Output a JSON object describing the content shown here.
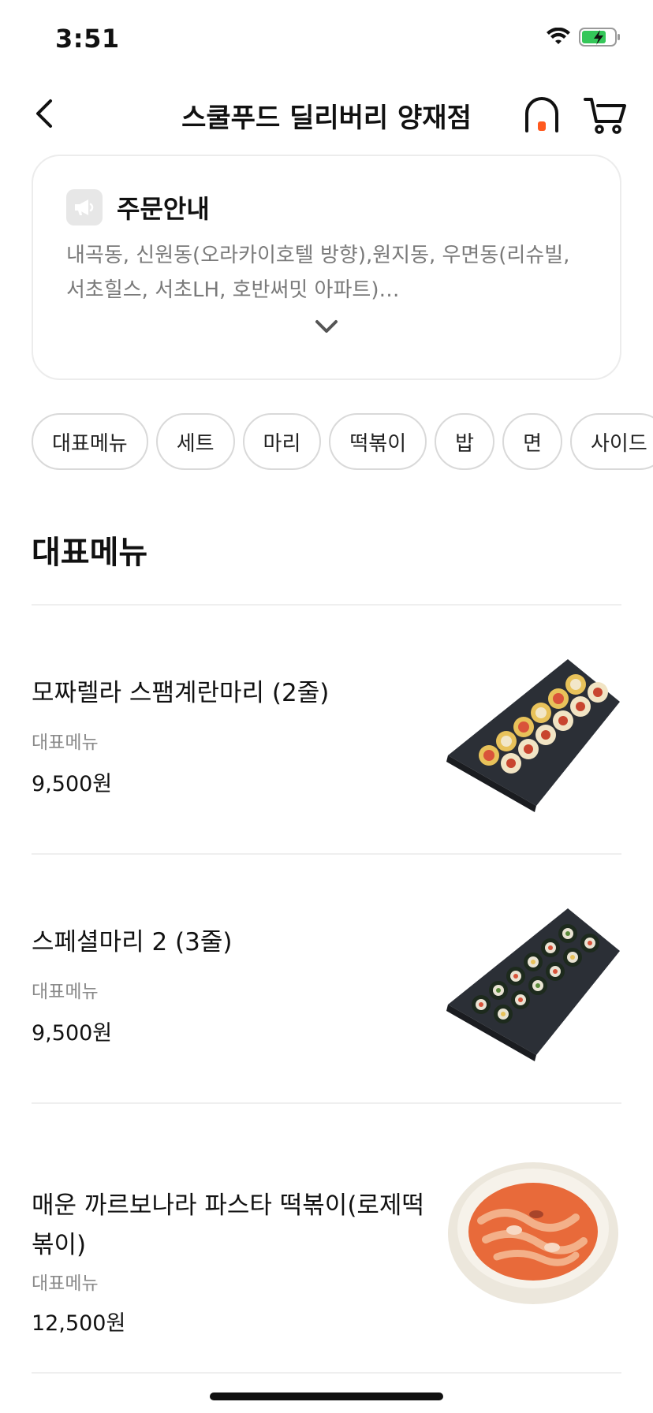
{
  "status_bar": {
    "time": "3:51"
  },
  "header": {
    "title": "스쿨푸드 딜리버리 양재점"
  },
  "notice": {
    "title": "주문안내",
    "line1": "내곡동, 신원동(오라카이호텔 방향),원지동, 우면동(리슈빌,",
    "line2": "서초힐스, 서초LH, 호반써밋 아파트)…"
  },
  "categories": [
    "대표메뉴",
    "세트",
    "마리",
    "떡볶이",
    "밥",
    "면",
    "사이드"
  ],
  "section": {
    "title": "대표메뉴"
  },
  "menu_items": [
    {
      "name": "모짜렐라 스팸계란마리 (2줄)",
      "category": "대표메뉴",
      "price": "9,500원"
    },
    {
      "name": "스페셜마리 2 (3줄)",
      "category": "대표메뉴",
      "price": "9,500원"
    },
    {
      "name_line1": "매운 까르보나라 파스타 떡볶이(로제떡",
      "name_line2": "볶이)",
      "category": "대표메뉴",
      "price": "12,500원"
    }
  ],
  "colors": {
    "accent": "#ff5a1f",
    "text": "#111111",
    "muted": "#7a7a7a",
    "border": "#d9d9d9"
  }
}
